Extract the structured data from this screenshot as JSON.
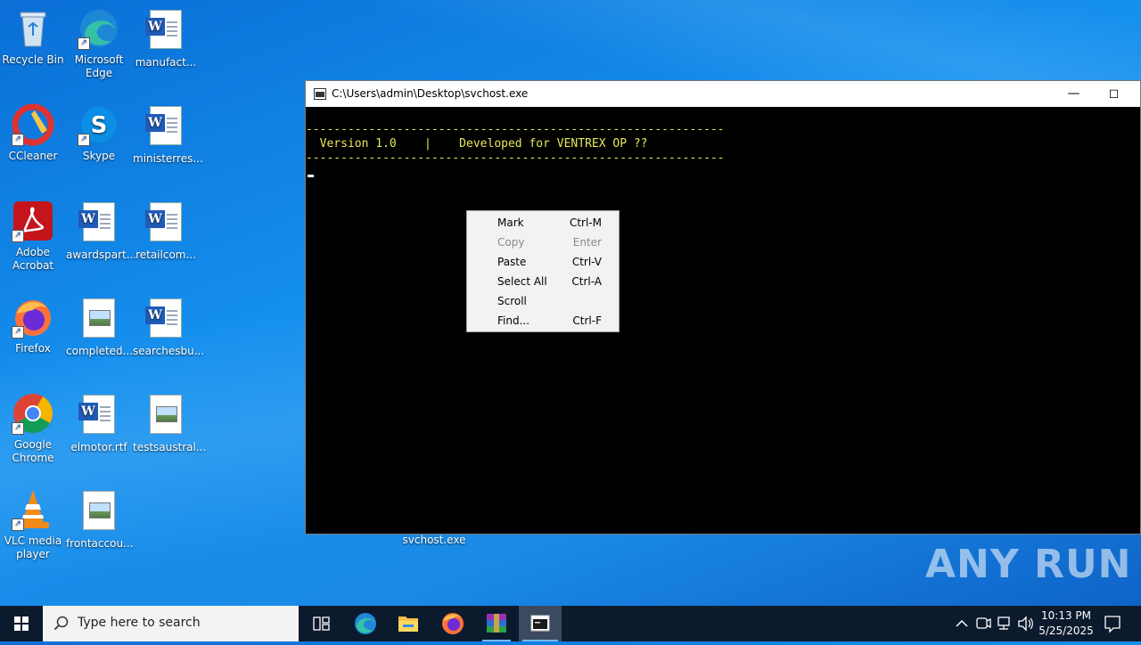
{
  "desktop_icons": [
    {
      "label": "Recycle Bin",
      "icon": "recycle-bin-icon"
    },
    {
      "label": "Microsoft Edge",
      "icon": "edge-icon"
    },
    {
      "label": "manufact...",
      "icon": "word-document-icon"
    },
    {
      "label": "CCleaner",
      "icon": "ccleaner-icon"
    },
    {
      "label": "Skype",
      "icon": "skype-icon"
    },
    {
      "label": "ministerres...",
      "icon": "word-document-icon"
    },
    {
      "label": "Adobe Acrobat",
      "icon": "acrobat-icon"
    },
    {
      "label": "awardspart...",
      "icon": "word-document-icon"
    },
    {
      "label": "retailcom...",
      "icon": "word-document-icon"
    },
    {
      "label": "Firefox",
      "icon": "firefox-icon"
    },
    {
      "label": "completed...",
      "icon": "image-document-icon"
    },
    {
      "label": "searchesbu...",
      "icon": "word-document-icon"
    },
    {
      "label": "Google Chrome",
      "icon": "chrome-icon"
    },
    {
      "label": "elmotor.rtf",
      "icon": "word-document-icon"
    },
    {
      "label": "testsaustral...",
      "icon": "image-document-icon"
    },
    {
      "label": "VLC media player",
      "icon": "vlc-icon"
    },
    {
      "label": "frontaccou...",
      "icon": "image-document-icon"
    }
  ],
  "desktop_under_window_label": "svchost.exe",
  "console": {
    "title": "C:\\Users\\admin\\Desktop\\svchost.exe",
    "lines": [
      "------------------------------------------------------------",
      "  Version 1.0    |    Developed for VENTREX OP ??",
      "------------------------------------------------------------"
    ],
    "text_color": "#e8e85a"
  },
  "context_menu": {
    "items": [
      {
        "label": "Mark",
        "shortcut": "Ctrl-M",
        "enabled": true
      },
      {
        "label": "Copy",
        "shortcut": "Enter",
        "enabled": false
      },
      {
        "label": "Paste",
        "shortcut": "Ctrl-V",
        "enabled": true
      },
      {
        "label": "Select All",
        "shortcut": "Ctrl-A",
        "enabled": true
      },
      {
        "label": "Scroll",
        "shortcut": "",
        "enabled": true
      },
      {
        "label": "Find...",
        "shortcut": "Ctrl-F",
        "enabled": true
      }
    ]
  },
  "watermark": "ANY RUN",
  "taskbar": {
    "search_placeholder": "Type here to search",
    "pinned": [
      "task-view-icon",
      "edge-icon",
      "file-explorer-icon",
      "firefox-icon",
      "winrar-icon",
      "console-icon"
    ],
    "time": "10:13 PM",
    "date": "5/25/2025"
  }
}
